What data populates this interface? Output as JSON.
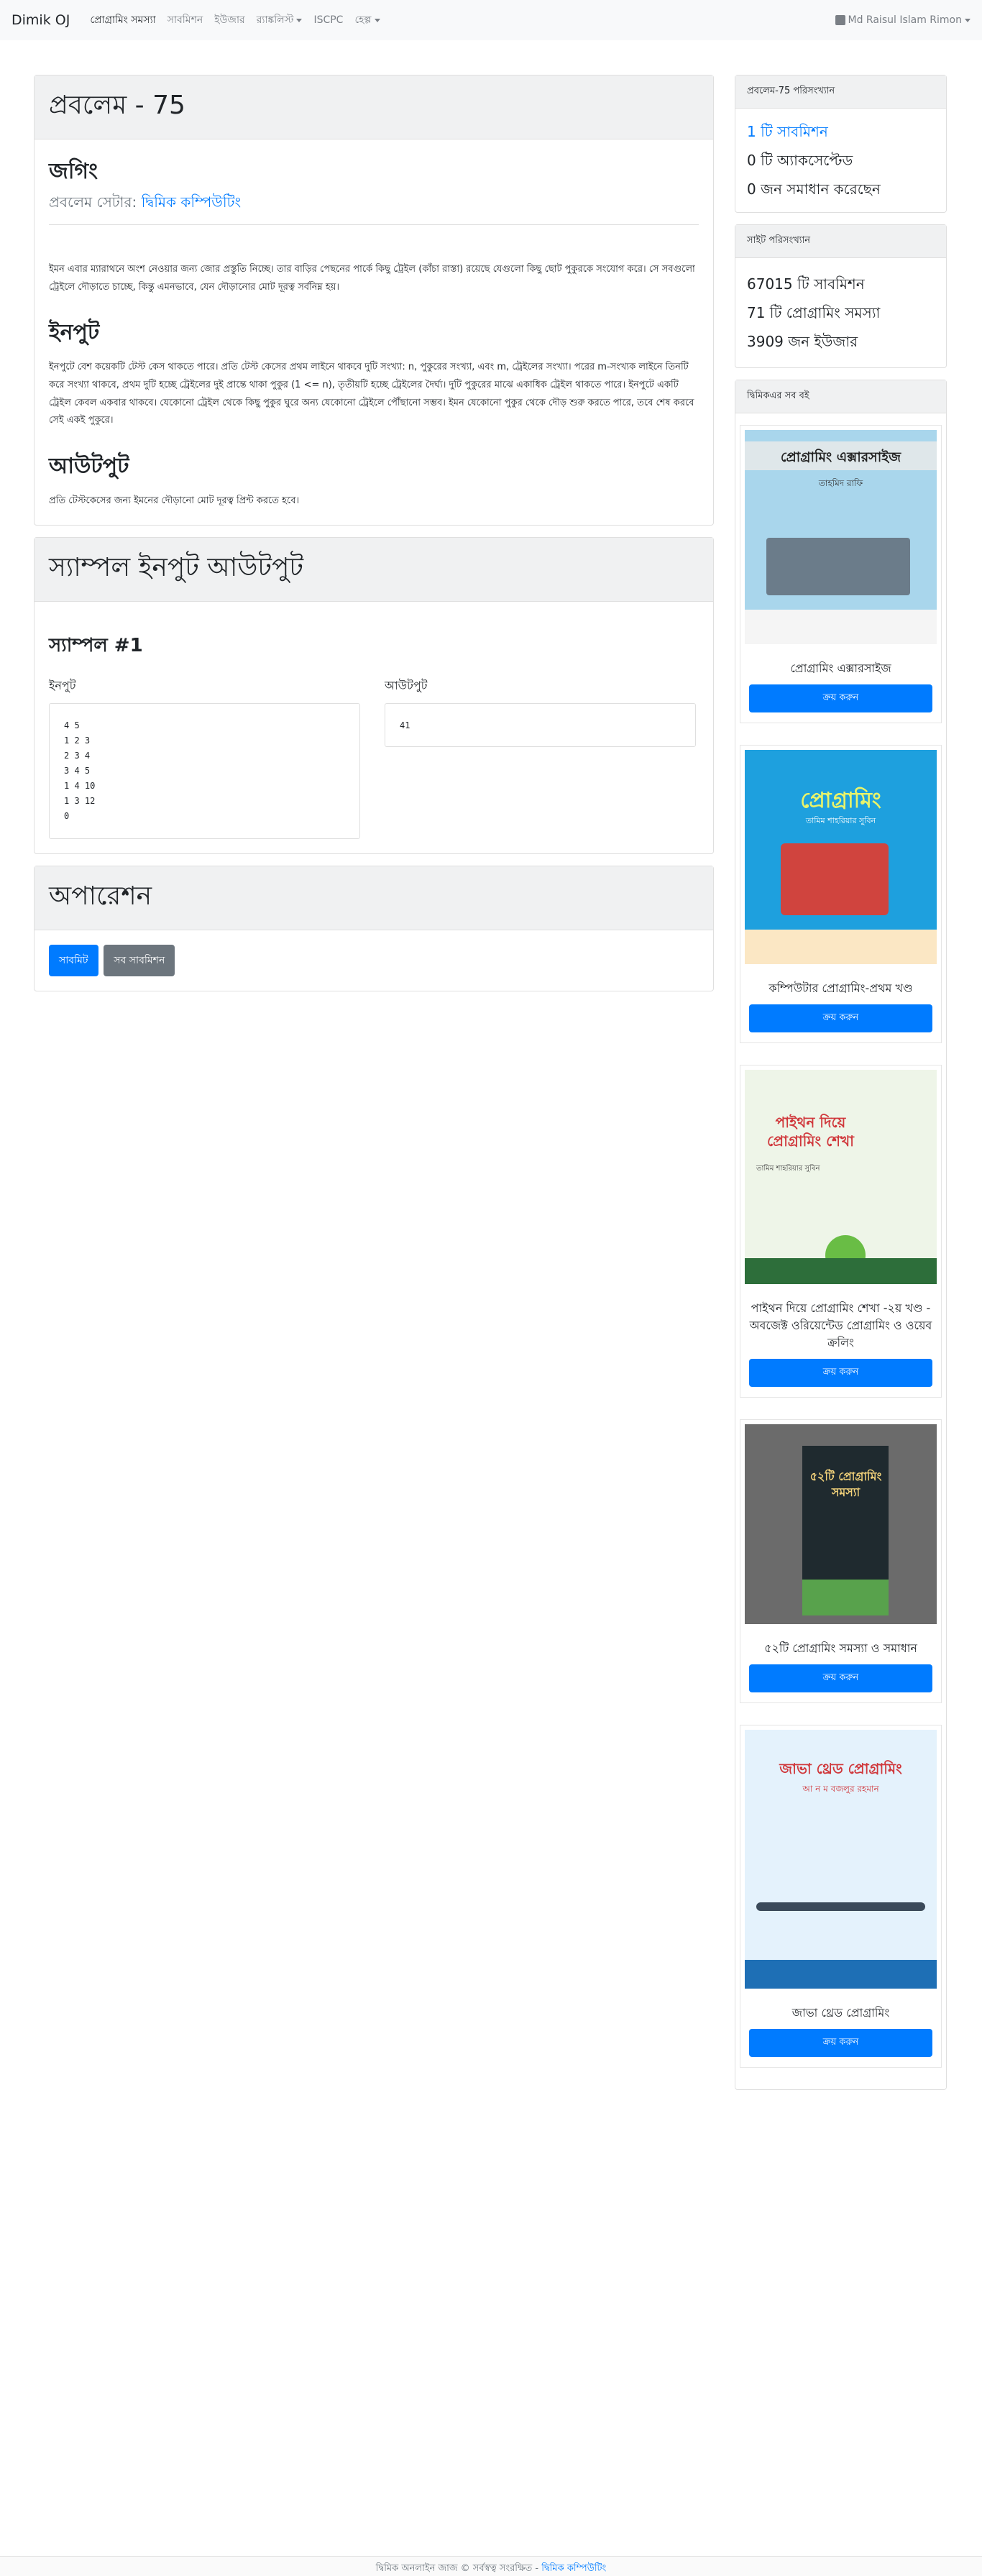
{
  "nav": {
    "brand": "Dimik OJ",
    "items": [
      "প্রোগ্রামিং সমস্যা",
      "সাবমিশন",
      "ইউজার",
      "র‍্যাঙ্কলিস্ট",
      "ISCPC",
      "হেল্প"
    ],
    "user": "Md Raisul Islam Rimon"
  },
  "problem": {
    "title": "প্রবলেম - 75",
    "name": "জগিং",
    "setter_label": "প্রবলেম সেটার:",
    "setter": "দ্বিমিক কম্পিউটিং",
    "statement": "ইমন এবার ম্যারাথনে অংশ নেওয়ার জন্য জোর প্রস্তুতি নিচ্ছে। তার বাড়ির পেছনের পার্কে কিছু ট্রেইল (কাঁচা রাস্তা) রয়েছে যেগুলো কিছু ছোট পুকুরকে সংযোগ করে। সে সবগুলো ট্রেইলে দৌড়াতে চাচ্ছে, কিন্তু এমনভাবে, যেন দৌড়ানোর মোট দূরত্ব সর্বনিম্ন হয়।",
    "input_head": "ইনপুট",
    "input_text": "ইনপুটে বেশ কয়েকটি টেস্ট কেস থাকতে পারে। প্রতি টেস্ট কেসের প্রথম লাইনে থাকবে দুটি সংখ্যা: n, পুকুরের সংখ্যা, এবং m, ট্রেইলের সংখ্যা। পরের m-সংখ্যক লাইনে তিনটি করে সংখ্যা থাকবে, প্রথম দুটি হচ্ছে ট্রেইলের দুই প্রান্তে থাকা পুকুর (1 <= n), তৃতীয়টি হচ্ছে ট্রেইলের দৈর্ঘ্য। দুটি পুকুরের মাঝে একাধিক ট্রেইল থাকতে পারে। ইনপুটে একটি ট্রেইল কেবল একবার থাকবে। যেকোনো ট্রেইল থেকে কিছু পুকুর ঘুরে অন্য যেকোনো ট্রেইলে পৌঁছানো সম্ভব। ইমন যেকোনো পুকুর থেকে দৌড় শুরু করতে পারে, তবে শেষ করবে সেই একই পুকুরে।",
    "output_head": "আউটপুট",
    "output_text": "প্রতি টেস্টকেসের জন্য ইমনের দৌড়ানো মোট দূরত্ব প্রিন্ট করতে হবে।"
  },
  "samples": {
    "header": "স্যাম্পল ইনপুট আউটপুট",
    "sample_title": "স্যাম্পল #1",
    "input_label": "ইনপুট",
    "output_label": "আউটপুট",
    "input": "4 5\n1 2 3\n2 3 4\n3 4 5\n1 4 10\n1 3 12\n0",
    "output": "41"
  },
  "operations": {
    "header": "অপারেশন",
    "submit": "সাবমিট",
    "all_submissions": "সব সাবমিশন"
  },
  "stats": {
    "header": "প্রবলেম-75 পরিসংখ্যান",
    "submissions": "1 টি সাবমিশন",
    "accepted": "0 টি অ্যাকসেপ্টেড",
    "solved": "0 জন সমাধান করেছেন"
  },
  "site": {
    "header": "সাইট পরিসংখ্যান",
    "submissions": "67015 টি সাবমিশন",
    "problems": "71 টি প্রোগ্রামিং সমস্যা",
    "users": "3909 জন ইউজার"
  },
  "books": {
    "header": "দ্বিমিকএর সব বই",
    "buy_label": "ক্রয় করুন",
    "items": [
      {
        "title": "প্রোগ্রামিং এক্সারসাইজ",
        "cover_title": "প্রোগ্রামিং এক্সারসাইজ",
        "cover_author": "তাহমিদ রাফি",
        "color": "#a9d6ec"
      },
      {
        "title": "কম্পিউটার প্রোগ্রামিং-প্রথম খণ্ড",
        "cover_title": "প্রোগ্রামিং",
        "cover_author": "তামিম শাহরিয়ার সুবিন",
        "color": "#1ea0de"
      },
      {
        "title": "পাইথন দিয়ে প্রোগ্রামিং শেখা -২য় খণ্ড - অবজেক্ট ওরিয়েন্টেড প্রোগ্রামিং ও ওয়েব ক্রলিং",
        "cover_title": "পাইথন দিয়ে প্রোগ্রামিং শেখা",
        "cover_author": "তামিম শাহরিয়ার সুবিন",
        "color": "#eef5e8"
      },
      {
        "title": "৫২টি প্রোগ্রামিং সমস্যা ও সমাধান",
        "cover_title": "৫২টি প্রোগ্রামিং সমস্যা",
        "cover_author": "",
        "color": "#6b6b6b"
      },
      {
        "title": "জাভা থ্রেড প্রোগ্রামিং",
        "cover_title": "জাভা থ্রেড প্রোগ্রামিং",
        "cover_author": "আ ন ম বজলুর রহমান",
        "color": "#e4f2fc"
      }
    ]
  },
  "footer": {
    "text": "দ্বিমিক অনলাইন জাজ © সর্বস্বত্ব সংরক্ষিত -",
    "link": "দ্বিমিক কম্পিউটিং"
  }
}
